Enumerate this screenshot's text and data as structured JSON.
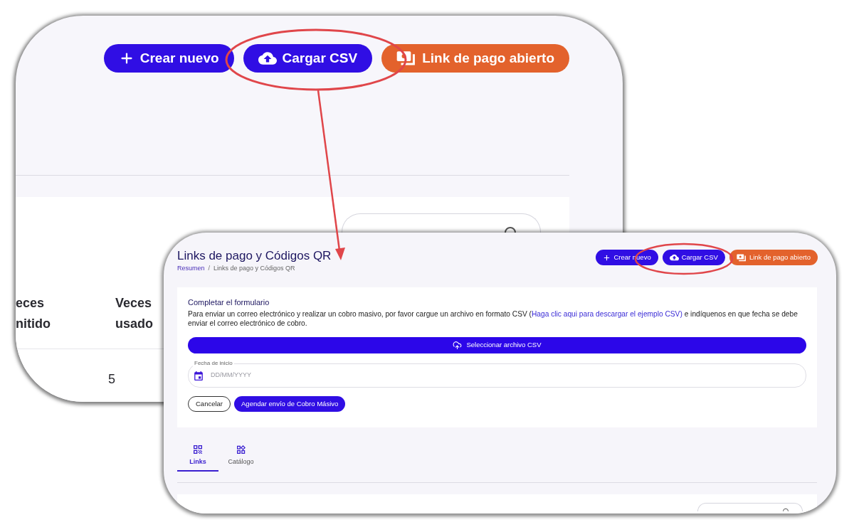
{
  "back_view": {
    "buttons": [
      {
        "label": "Crear nuevo",
        "kind": "create"
      },
      {
        "label": "Cargar CSV",
        "kind": "upload"
      },
      {
        "label": "Link de pago abierto",
        "kind": "open_link"
      }
    ],
    "table": {
      "columns": [
        {
          "label": "eces nitido"
        },
        {
          "label": "Veces usado",
          "cells": [
            "5"
          ]
        }
      ]
    }
  },
  "front_view": {
    "title": "Links de pago y Códigos QR",
    "breadcrumb": {
      "separator": "/",
      "items": [
        {
          "label": "Resumen",
          "kind": "link"
        },
        {
          "label": "Links de pago y Códigos QR",
          "kind": "current"
        }
      ]
    },
    "buttons": [
      {
        "label": "Crear nuevo",
        "kind": "create"
      },
      {
        "label": "Cargar CSV",
        "kind": "upload"
      },
      {
        "label": "Link de pago abierto",
        "kind": "open_link"
      }
    ],
    "form": {
      "title": "Completar el formulario",
      "description_start": "Para enviar un correo electrónico y realizar un cobro masivo, por favor cargue un archivo en formato CSV (",
      "link": "Haga clic aqui para descargar el ejemplo CSV)",
      "description_end": " e indíquenos en que fecha se debe enviar el correo electrónico de cobro.",
      "upload_button": "Seleccionar archivo CSV",
      "date_field": {
        "label": "Fecha de inicio",
        "placeholder": "DD/MM/YYYY"
      },
      "actions": [
        {
          "label": "Cancelar",
          "kind": "outline"
        },
        {
          "label": "Agendar envío de Cobro Másivo",
          "kind": "primary"
        }
      ]
    },
    "tabs": [
      {
        "label": "Links",
        "selected": true
      },
      {
        "label": "Catálogo",
        "selected": false
      }
    ]
  }
}
